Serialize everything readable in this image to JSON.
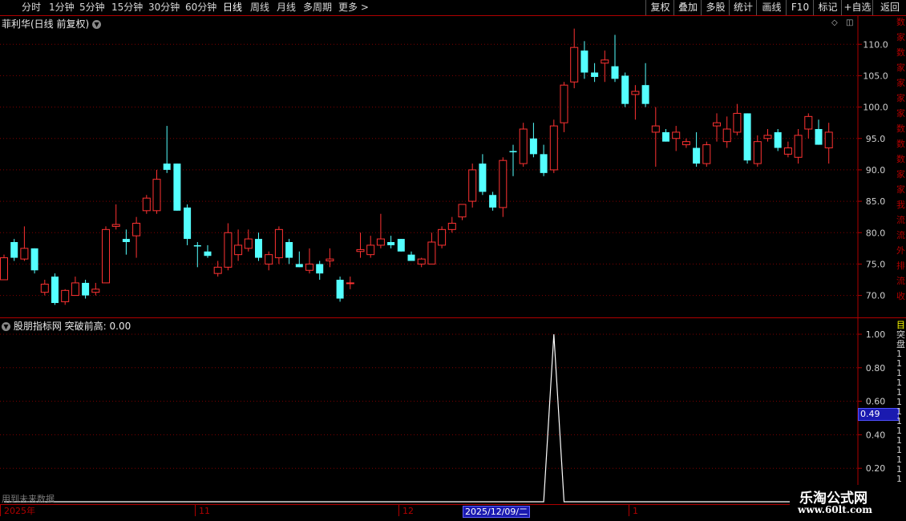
{
  "toolbar": {
    "periods": [
      "分时",
      "1分钟",
      "5分钟",
      "15分钟",
      "30分钟",
      "60分钟",
      "日线",
      "周线",
      "月线",
      "多周期",
      "更多 >"
    ],
    "active_period": "日线",
    "right_buttons": [
      "复权",
      "叠加",
      "多股",
      "统计",
      "画线",
      "F10",
      "标记",
      "+自选",
      "返回"
    ]
  },
  "main_chart": {
    "title": "菲利华(日线 前复权)",
    "y_ticks": [
      "110.0",
      "105.0",
      "100.0",
      "95.0",
      "90.0",
      "85.0",
      "80.0",
      "75.0",
      "70.0"
    ]
  },
  "indicator": {
    "title": "股朋指标网 突破前高: 0.00",
    "y_ticks": [
      "1.00",
      "0.80",
      "0.60",
      "0.40",
      "0.20"
    ],
    "cursor_value": "0.49",
    "warning": "用到未来数据"
  },
  "x_axis": {
    "labels": [
      "2025年",
      "11",
      "12",
      "1"
    ],
    "cursor_date": "2025/12/09/二"
  },
  "right_strip_top": [
    "数",
    "家",
    "数",
    "家",
    "家",
    "家",
    "家",
    "数",
    "数",
    "数",
    "家",
    "家",
    "我",
    "流",
    "流",
    "外",
    "排",
    "流",
    "收"
  ],
  "right_strip_bottom": [
    "目",
    "突",
    "盘",
    "1",
    "1",
    "1",
    "1",
    "1",
    "1",
    "1",
    "1",
    "1",
    "1",
    "1",
    "1",
    "1",
    "1",
    "1",
    "1"
  ],
  "watermark": {
    "name": "乐淘公式网",
    "url": "www.60lt.com"
  },
  "colors": {
    "up": "#ff3232",
    "down": "#54ffff",
    "grid": "#800000",
    "axis": "#b00000"
  },
  "chart_data": {
    "type": "candlestick",
    "ylim": [
      66.5,
      114.5
    ],
    "candles": [
      {
        "o": 72.5,
        "h": 76.5,
        "l": 72.5,
        "c": 76.0
      },
      {
        "o": 78.5,
        "h": 79.0,
        "l": 75.5,
        "c": 76.0
      },
      {
        "o": 75.8,
        "h": 81.0,
        "l": 75.5,
        "c": 77.5
      },
      {
        "o": 77.5,
        "h": 77.5,
        "l": 73.5,
        "c": 74.0
      },
      {
        "o": 70.5,
        "h": 72.5,
        "l": 70.0,
        "c": 71.8
      },
      {
        "o": 73.0,
        "h": 73.5,
        "l": 68.5,
        "c": 68.8
      },
      {
        "o": 69.0,
        "h": 71.0,
        "l": 68.5,
        "c": 70.8
      },
      {
        "o": 70.0,
        "h": 73.0,
        "l": 70.0,
        "c": 72.0
      },
      {
        "o": 72.0,
        "h": 72.5,
        "l": 69.5,
        "c": 70.0
      },
      {
        "o": 70.5,
        "h": 72.0,
        "l": 70.0,
        "c": 71.0
      },
      {
        "o": 72.0,
        "h": 81.0,
        "l": 72.0,
        "c": 80.5
      },
      {
        "o": 81.0,
        "h": 84.5,
        "l": 80.5,
        "c": 81.3
      },
      {
        "o": 79.0,
        "h": 80.5,
        "l": 76.5,
        "c": 78.5
      },
      {
        "o": 79.5,
        "h": 82.5,
        "l": 76.0,
        "c": 81.5
      },
      {
        "o": 83.5,
        "h": 86.0,
        "l": 83.0,
        "c": 85.5
      },
      {
        "o": 83.5,
        "h": 90.0,
        "l": 83.0,
        "c": 88.5
      },
      {
        "o": 91.0,
        "h": 97.0,
        "l": 89.5,
        "c": 90.0
      },
      {
        "o": 91.0,
        "h": 91.0,
        "l": 83.5,
        "c": 83.5
      },
      {
        "o": 84.0,
        "h": 84.5,
        "l": 78.0,
        "c": 79.0
      },
      {
        "o": 78.0,
        "h": 78.5,
        "l": 74.5,
        "c": 77.8
      },
      {
        "o": 77.0,
        "h": 78.0,
        "l": 76.0,
        "c": 76.3
      },
      {
        "o": 73.5,
        "h": 75.5,
        "l": 73.0,
        "c": 74.5
      },
      {
        "o": 74.5,
        "h": 81.5,
        "l": 74.0,
        "c": 80.0
      },
      {
        "o": 76.5,
        "h": 80.5,
        "l": 75.5,
        "c": 78.0
      },
      {
        "o": 77.5,
        "h": 80.5,
        "l": 77.0,
        "c": 79.0
      },
      {
        "o": 79.0,
        "h": 80.0,
        "l": 75.5,
        "c": 76.0
      },
      {
        "o": 75.0,
        "h": 77.0,
        "l": 74.0,
        "c": 76.5
      },
      {
        "o": 76.0,
        "h": 81.0,
        "l": 75.0,
        "c": 80.5
      },
      {
        "o": 78.5,
        "h": 79.0,
        "l": 75.0,
        "c": 76.0
      },
      {
        "o": 75.0,
        "h": 77.0,
        "l": 74.5,
        "c": 74.5
      },
      {
        "o": 74.0,
        "h": 77.5,
        "l": 73.5,
        "c": 75.0
      },
      {
        "o": 75.0,
        "h": 75.5,
        "l": 72.5,
        "c": 73.5
      },
      {
        "o": 75.5,
        "h": 77.5,
        "l": 74.5,
        "c": 75.8
      },
      {
        "o": 72.5,
        "h": 73.0,
        "l": 69.0,
        "c": 69.5
      },
      {
        "o": 72.0,
        "h": 73.0,
        "l": 71.0,
        "c": 72.0
      },
      {
        "o": 77.0,
        "h": 80.0,
        "l": 76.0,
        "c": 77.3
      },
      {
        "o": 76.5,
        "h": 79.5,
        "l": 76.0,
        "c": 78.0
      },
      {
        "o": 78.0,
        "h": 83.0,
        "l": 77.5,
        "c": 79.0
      },
      {
        "o": 78.5,
        "h": 79.5,
        "l": 77.5,
        "c": 78.0
      },
      {
        "o": 79.0,
        "h": 79.0,
        "l": 77.0,
        "c": 77.0
      },
      {
        "o": 76.5,
        "h": 77.0,
        "l": 75.5,
        "c": 75.5
      },
      {
        "o": 75.0,
        "h": 76.0,
        "l": 74.5,
        "c": 75.8
      },
      {
        "o": 75.0,
        "h": 80.0,
        "l": 75.0,
        "c": 78.5
      },
      {
        "o": 78.0,
        "h": 81.0,
        "l": 77.5,
        "c": 80.5
      },
      {
        "o": 80.5,
        "h": 82.5,
        "l": 80.0,
        "c": 81.5
      },
      {
        "o": 82.5,
        "h": 84.5,
        "l": 82.0,
        "c": 84.5
      },
      {
        "o": 85.0,
        "h": 91.0,
        "l": 84.0,
        "c": 90.0
      },
      {
        "o": 91.0,
        "h": 92.5,
        "l": 86.0,
        "c": 86.5
      },
      {
        "o": 86.0,
        "h": 86.5,
        "l": 83.5,
        "c": 84.0
      },
      {
        "o": 84.0,
        "h": 92.0,
        "l": 82.5,
        "c": 91.5
      },
      {
        "o": 93.0,
        "h": 94.0,
        "l": 89.0,
        "c": 92.8
      },
      {
        "o": 91.0,
        "h": 97.5,
        "l": 90.5,
        "c": 96.5
      },
      {
        "o": 95.0,
        "h": 97.5,
        "l": 92.0,
        "c": 92.5
      },
      {
        "o": 92.5,
        "h": 94.0,
        "l": 89.0,
        "c": 89.5
      },
      {
        "o": 90.0,
        "h": 98.0,
        "l": 89.5,
        "c": 97.0
      },
      {
        "o": 97.5,
        "h": 104.0,
        "l": 96.0,
        "c": 103.5
      },
      {
        "o": 104.0,
        "h": 112.5,
        "l": 103.0,
        "c": 109.5
      },
      {
        "o": 109.0,
        "h": 110.5,
        "l": 104.5,
        "c": 105.5
      },
      {
        "o": 105.5,
        "h": 107.0,
        "l": 104.0,
        "c": 104.8
      },
      {
        "o": 107.0,
        "h": 109.0,
        "l": 104.0,
        "c": 107.5
      },
      {
        "o": 106.5,
        "h": 111.5,
        "l": 104.0,
        "c": 104.5
      },
      {
        "o": 105.0,
        "h": 105.5,
        "l": 100.0,
        "c": 100.5
      },
      {
        "o": 102.0,
        "h": 103.5,
        "l": 98.0,
        "c": 102.5
      },
      {
        "o": 103.5,
        "h": 107.0,
        "l": 100.0,
        "c": 100.5
      },
      {
        "o": 96.0,
        "h": 100.0,
        "l": 90.5,
        "c": 97.0
      },
      {
        "o": 96.0,
        "h": 96.5,
        "l": 94.5,
        "c": 94.5
      },
      {
        "o": 95.0,
        "h": 97.0,
        "l": 93.0,
        "c": 96.0
      },
      {
        "o": 94.0,
        "h": 95.0,
        "l": 93.5,
        "c": 94.5
      },
      {
        "o": 93.5,
        "h": 96.0,
        "l": 90.5,
        "c": 91.0
      },
      {
        "o": 91.0,
        "h": 94.5,
        "l": 90.5,
        "c": 94.0
      },
      {
        "o": 97.0,
        "h": 99.0,
        "l": 94.5,
        "c": 97.5
      },
      {
        "o": 94.5,
        "h": 98.5,
        "l": 93.5,
        "c": 96.5
      },
      {
        "o": 96.0,
        "h": 100.5,
        "l": 95.5,
        "c": 99.0
      },
      {
        "o": 99.0,
        "h": 99.0,
        "l": 91.0,
        "c": 91.5
      },
      {
        "o": 91.0,
        "h": 95.5,
        "l": 90.5,
        "c": 94.5
      },
      {
        "o": 95.0,
        "h": 96.5,
        "l": 94.5,
        "c": 95.5
      },
      {
        "o": 96.0,
        "h": 96.5,
        "l": 93.0,
        "c": 93.5
      },
      {
        "o": 92.5,
        "h": 94.5,
        "l": 92.0,
        "c": 93.5
      },
      {
        "o": 92.0,
        "h": 96.5,
        "l": 91.0,
        "c": 95.5
      },
      {
        "o": 96.5,
        "h": 99.0,
        "l": 95.0,
        "c": 98.5
      },
      {
        "o": 96.5,
        "h": 98.0,
        "l": 94.0,
        "c": 94.0
      },
      {
        "o": 93.5,
        "h": 97.5,
        "l": 91.0,
        "c": 96.0
      }
    ],
    "indicator_series": {
      "name": "突破前高",
      "values": [
        0,
        0,
        0,
        0,
        0,
        0,
        0,
        0,
        0,
        0,
        0,
        0,
        0,
        0,
        0,
        0,
        0,
        0,
        0,
        0,
        0,
        0,
        0,
        0,
        0,
        0,
        0,
        0,
        0,
        0,
        0,
        0,
        0,
        0,
        0,
        0,
        0,
        0,
        0,
        0,
        0,
        0,
        0,
        0,
        0,
        0,
        0,
        0,
        0,
        0,
        0,
        0,
        0,
        0,
        1,
        0,
        0,
        0,
        0,
        0,
        0,
        0,
        0,
        0,
        0,
        0,
        0,
        0,
        0,
        0,
        0,
        0,
        0,
        0,
        0,
        0,
        0,
        0,
        0,
        0,
        0
      ],
      "ylim": [
        0,
        1.0
      ]
    }
  }
}
